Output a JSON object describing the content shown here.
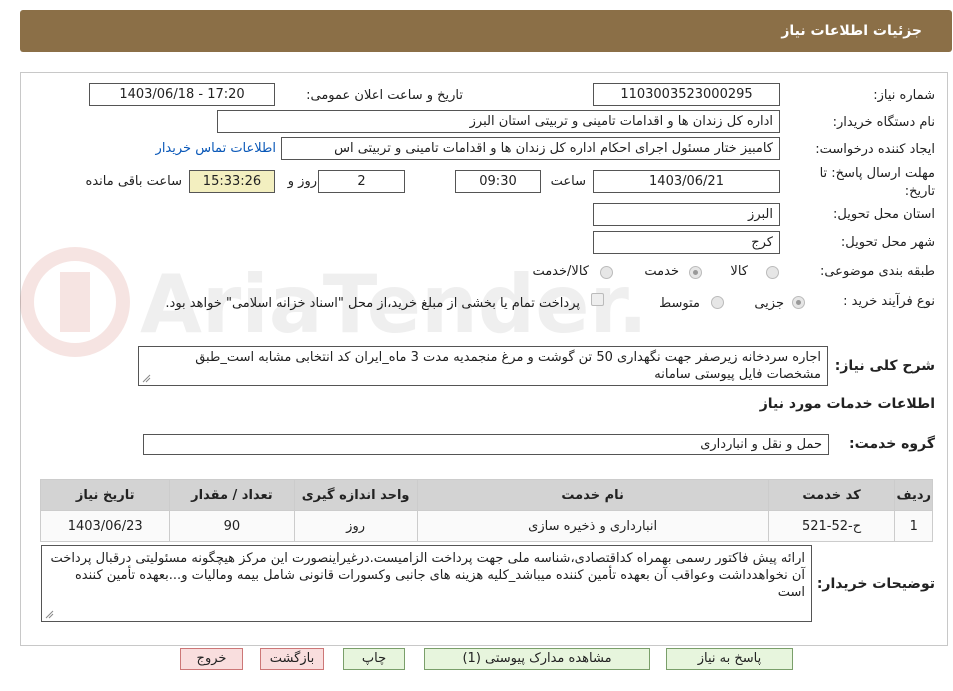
{
  "header": {
    "title": "جزئیات اطلاعات نیاز"
  },
  "fields": {
    "need_number_label": "شماره نیاز:",
    "need_number": "1103003523000295",
    "announce_label": "تاریخ و ساعت اعلان عمومی:",
    "announce_value": "1403/06/18 - 17:20",
    "buyer_label": "نام دستگاه خریدار:",
    "buyer_value": "اداره کل زندان ها و اقدامات تامینی و تربیتی استان البرز",
    "requester_label": "ایجاد کننده درخواست:",
    "requester_value": "کامبیز ختار مسئول اجرای احکام اداره کل زندان ها و اقدامات تامینی و تربیتی اس",
    "contact_link": "اطلاعات تماس خریدار",
    "deadline_label_1": "مهلت ارسال پاسخ: تا",
    "deadline_label_2": "تاریخ:",
    "deadline_date": "1403/06/21",
    "time_label": "ساعت",
    "deadline_time": "09:30",
    "days_value": "2",
    "days_label": "روز و",
    "remaining_time": "15:33:26",
    "remaining_label": "ساعت باقی مانده",
    "province_label": "استان محل تحویل:",
    "province_value": "البرز",
    "city_label": "شهر محل تحویل:",
    "city_value": "کرج",
    "category_label": "طبقه بندی موضوعی:",
    "category_options": [
      "کالا",
      "خدمت",
      "کالا/خدمت"
    ],
    "category_selected": "خدمت",
    "process_label": "نوع فرآیند خرید :",
    "process_options": [
      "جزیی",
      "متوسط"
    ],
    "payment_note": "پرداخت تمام یا بخشی از مبلغ خرید،از محل \"اسناد خزانه اسلامی\" خواهد بود.",
    "summary_label": "شرح کلی نیاز:",
    "summary_value": "اجاره سردخانه زیرصفر جهت نگهداری 50 تن گوشت و مرغ منجمدیه مدت 3 ماه_ایران کد انتخابی مشابه است_طبق مشخصات فایل پیوستی سامانه"
  },
  "services": {
    "section_title": "اطلاعات خدمات مورد نیاز",
    "group_label": "گروه خدمت:",
    "group_value": "حمل و نقل و انبارداری",
    "columns": [
      "ردیف",
      "کد خدمت",
      "نام خدمت",
      "واحد اندازه گیری",
      "تعداد / مقدار",
      "تاریخ نیاز"
    ],
    "rows": [
      [
        "1",
        "ح-52-521",
        "انبارداری و ذخیره سازی",
        "روز",
        "90",
        "1403/06/23"
      ]
    ]
  },
  "buyer_notes": {
    "label": "توضیحات خریدار:",
    "value": "ارائه پیش فاکتور رسمی بهمراه کداقتصادی،شناسه ملی جهت پرداخت الزامیست.درغیراینصورت این مرکز هیچگونه مسئولیتی درقبال پرداخت آن نخواهدداشت وعواقب آن بعهده تأمین کننده میباشد_کلیه هزینه های جانبی وکسورات قانونی شامل بیمه ومالیات و...بعهده تأمین کننده است"
  },
  "buttons": {
    "reply": "پاسخ به نیاز",
    "attachments": "مشاهده مدارک پیوستی (1)",
    "print": "چاپ",
    "back": "بازگشت",
    "exit": "خروج"
  },
  "watermark": {
    "text": "AriaTender.neT"
  },
  "colors": {
    "header_bg": "#8b6f47",
    "remaining_bg": "#f3efc0",
    "button_green": "#e7f5dd",
    "button_red": "#f9dede",
    "link": "#0a58b8"
  }
}
